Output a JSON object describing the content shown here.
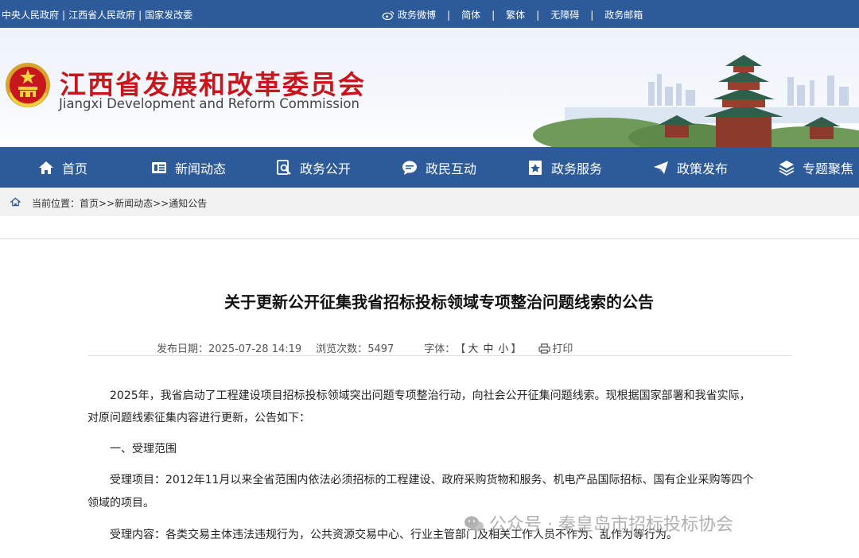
{
  "topbar": {
    "left_links": [
      "中央人民政府",
      "江西省人民政府",
      "国家发改委"
    ],
    "separator": "|",
    "right_links": [
      "政务微博",
      "简体",
      "繁体",
      "无障碍",
      "政务邮箱"
    ]
  },
  "header": {
    "title_cn": "江西省发展和改革委员会",
    "title_en": "Jiangxi Development and Reform Commission"
  },
  "nav": {
    "items": [
      {
        "label": "首页",
        "icon": "home-icon"
      },
      {
        "label": "新闻动态",
        "icon": "news-icon"
      },
      {
        "label": "政务公开",
        "icon": "document-search-icon"
      },
      {
        "label": "政民互动",
        "icon": "chat-icon"
      },
      {
        "label": "政务服务",
        "icon": "star-bookmark-icon"
      },
      {
        "label": "政策发布",
        "icon": "paper-plane-icon"
      },
      {
        "label": "专题聚焦",
        "icon": "layers-icon"
      }
    ]
  },
  "breadcrumb": {
    "prefix": "当前位置：",
    "items": [
      "首页",
      "新闻动态",
      "通知公告"
    ],
    "separator": ">>"
  },
  "article": {
    "title": "关于更新公开征集我省招标投标领域专项整治问题线索的公告",
    "publish_label": "发布日期：",
    "publish_date": "2025-07-28 14:19",
    "views_label": "浏览次数：",
    "views": "5497",
    "font_label": "字体：",
    "font_open": "【",
    "font_sizes": [
      "大",
      "中",
      "小"
    ],
    "font_close": "】",
    "print_label": "打印",
    "paragraphs": [
      "2025年，我省启动了工程建设项目招标投标领域突出问题专项整治行动，向社会公开征集问题线索。现根据国家部署和我省实际，",
      "对原问题线索征集内容进行更新，公告如下：",
      "一、受理范围",
      "受理项目：2012年11月以来全省范围内依法必须招标的工程建设、政府采购货物和服务、机电产品国际招标、国有企业采购等四个",
      "领域的项目。",
      "受理内容：各类交易主体违法违规行为，公共资源交易中心、行业主管部门及相关工作人员不作为、乱作为等行为。"
    ]
  },
  "watermark": "公众号 · 秦皇岛市招标投标协会",
  "colors": {
    "primary": "#2d5a98",
    "title_red": "#c8161d",
    "breadcrumb_bg": "#f2f2f2"
  }
}
